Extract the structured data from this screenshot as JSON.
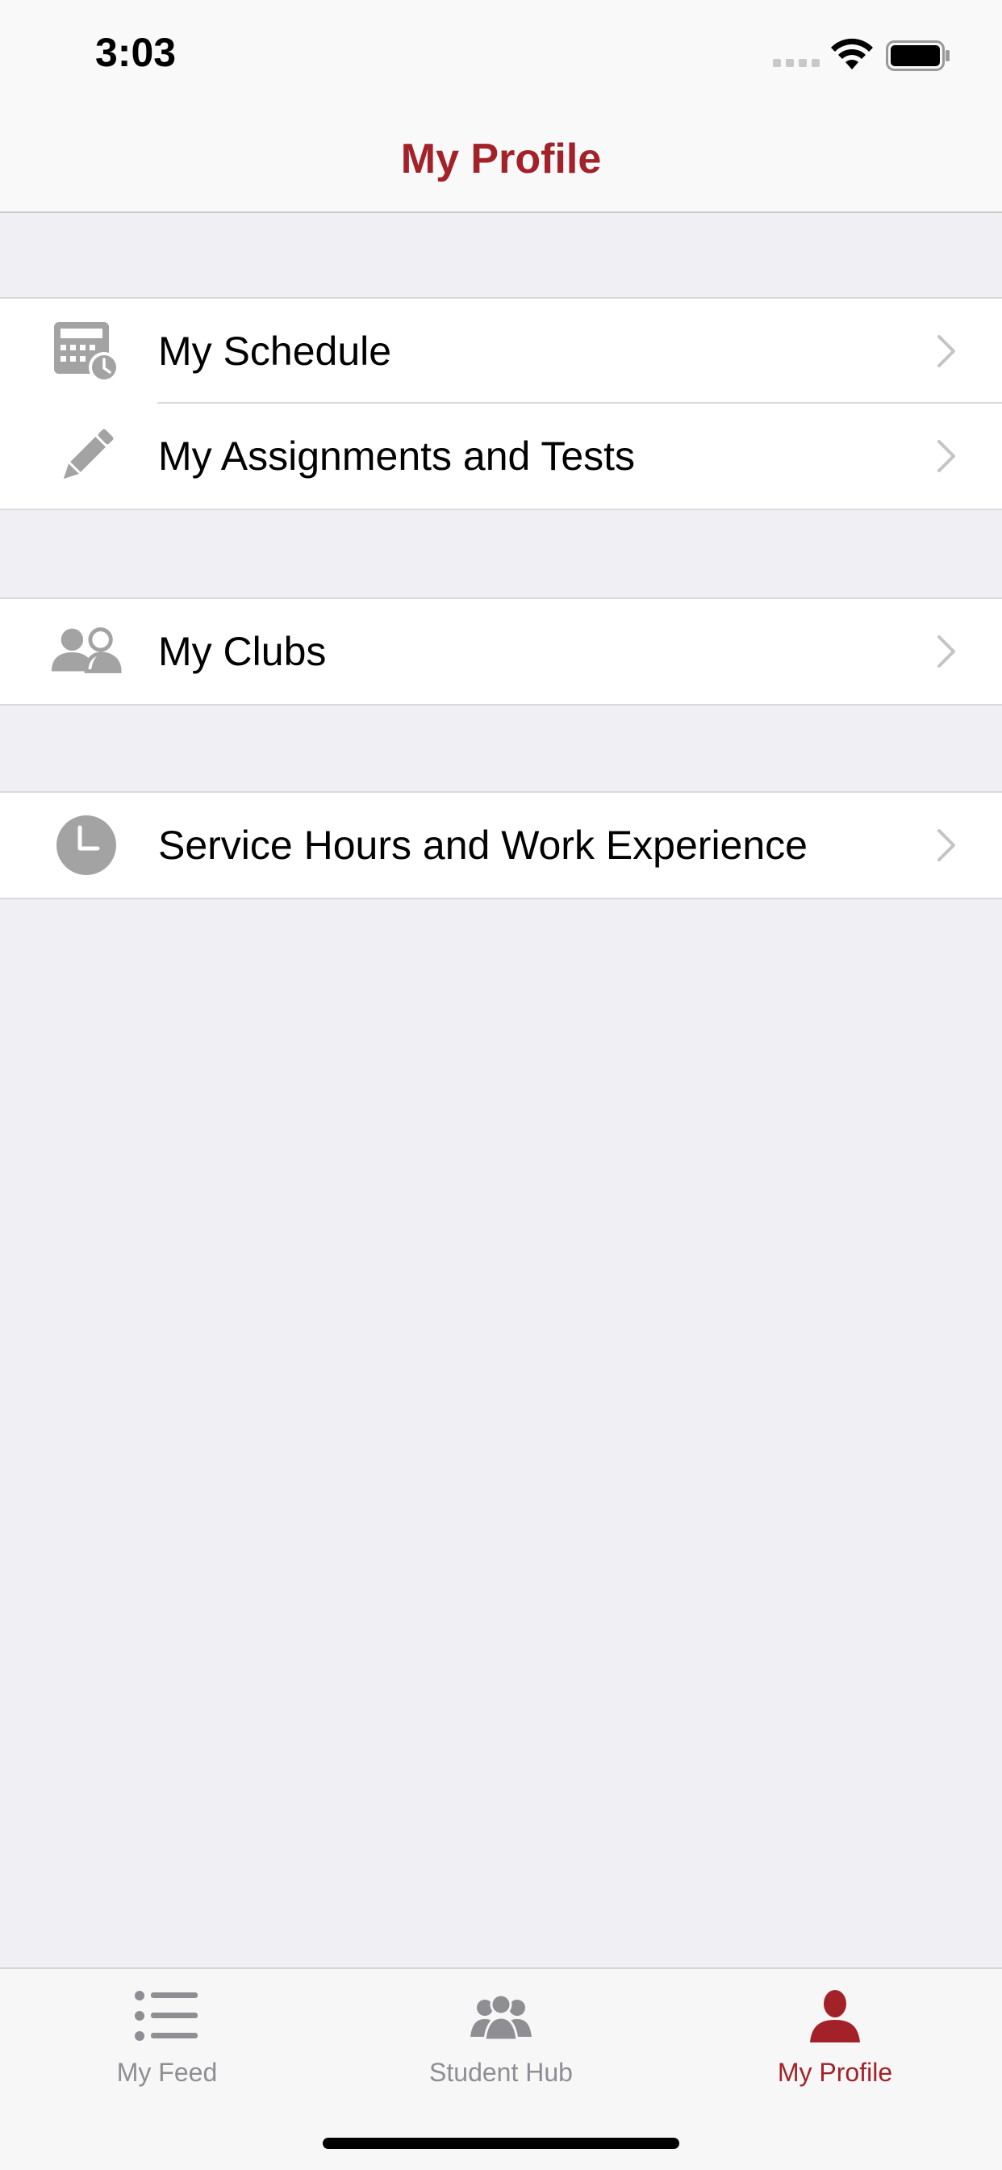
{
  "status_bar": {
    "time": "3:03"
  },
  "header": {
    "title": "My Profile"
  },
  "groups": [
    {
      "rows": [
        {
          "label": "My Schedule",
          "icon": "calendar-clock-icon"
        },
        {
          "label": "My Assignments and Tests",
          "icon": "pencil-icon"
        }
      ]
    },
    {
      "rows": [
        {
          "label": "My Clubs",
          "icon": "people-icon"
        }
      ]
    },
    {
      "rows": [
        {
          "label": "Service Hours and Work Experience",
          "icon": "clock-icon"
        }
      ]
    }
  ],
  "tab_bar": {
    "tabs": [
      {
        "label": "My Feed",
        "icon": "list-icon",
        "active": false
      },
      {
        "label": "Student Hub",
        "icon": "group-icon",
        "active": false
      },
      {
        "label": "My Profile",
        "icon": "person-icon",
        "active": true
      }
    ]
  },
  "colors": {
    "accent": "#a3222a",
    "icon_gray": "#a3a3a3",
    "chevron": "#c4c4c7",
    "background": "#efeff4"
  }
}
